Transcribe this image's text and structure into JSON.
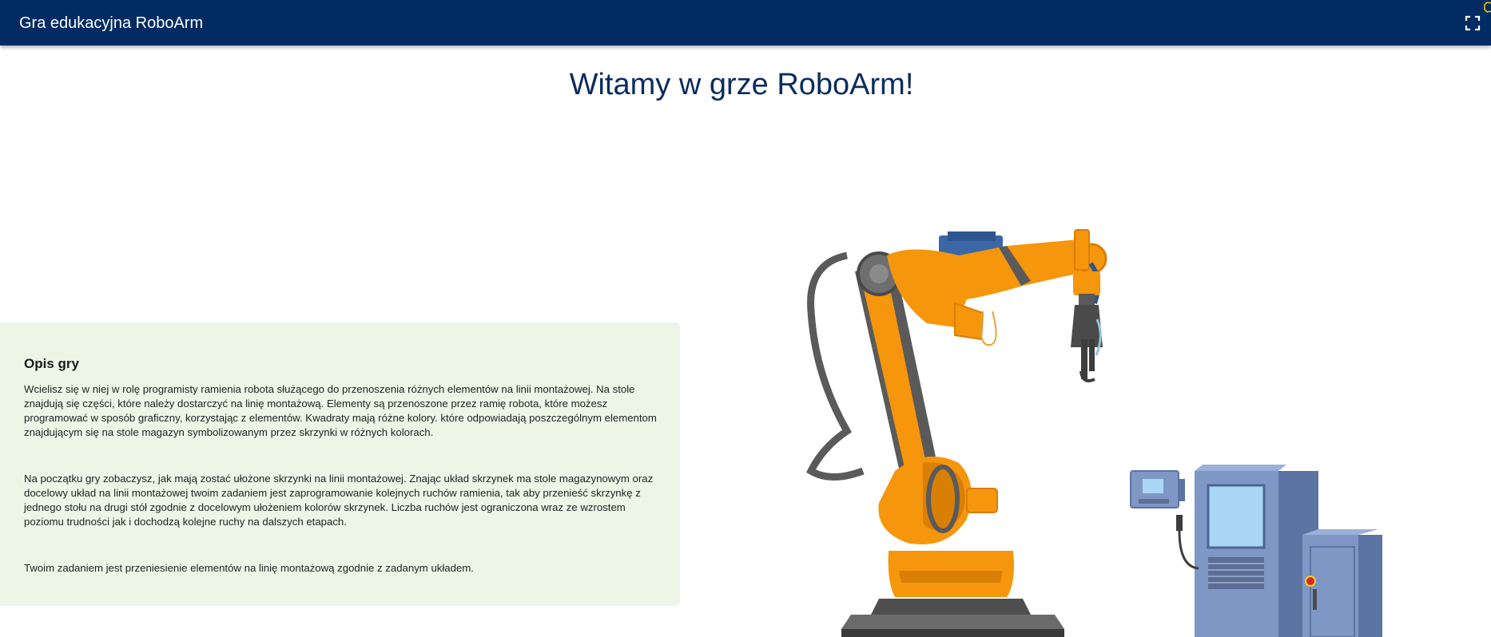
{
  "header": {
    "title": "Gra edukacyjna RoboArm",
    "fullscreen_icon": "fullscreen-icon"
  },
  "main": {
    "title": "Witamy w grze RoboArm!"
  },
  "description": {
    "heading": "Opis gry",
    "paragraphs": [
      "Wcielisz się w niej w rolę programisty ramienia robota służącego do przenoszenia różnych elementów na linii montażowej. Na stole znajdują się części, które należy dostarczyć na linię montażową. Elementy są przenoszone przez ramię robota, które możesz programować w sposób graficzny, korzystając z elementów. Kwadraty mają różne kolory. które odpowiadają poszczególnym elementom znajdującym się na stole magazyn symbolizowanym przez skrzynki w różnych kolorach.",
      "Na początku gry zobaczysz, jak mają zostać ułożone skrzynki na linii montażowej. Znając układ skrzynek ma stole magazynowym oraz docelowy układ na linii montażowej twoim zadaniem jest zaprogramowanie kolejnych ruchów ramienia, tak aby przenieść skrzynkę z jednego stołu na drugi stół zgodnie z docelowym ułożeniem kolorów skrzynek. Liczba ruchów jest ograniczona wraz ze wzrostem poziomu trudności jak i dochodzą kolejne ruchy na dalszych etapach.",
      "Twoim zadaniem jest przeniesienie elementów na linię montażową zgodnie z zadanym układem."
    ]
  },
  "illustration": {
    "name": "industrial-robot-arm-illustration",
    "colors": {
      "header_bg": "#002b63",
      "title_text": "#0b2c5e",
      "panel_bg": "#edf5e6",
      "robot_orange": "#f5960c",
      "robot_dark": "#5a5a5a",
      "console_blue": "#6f87b5"
    }
  }
}
